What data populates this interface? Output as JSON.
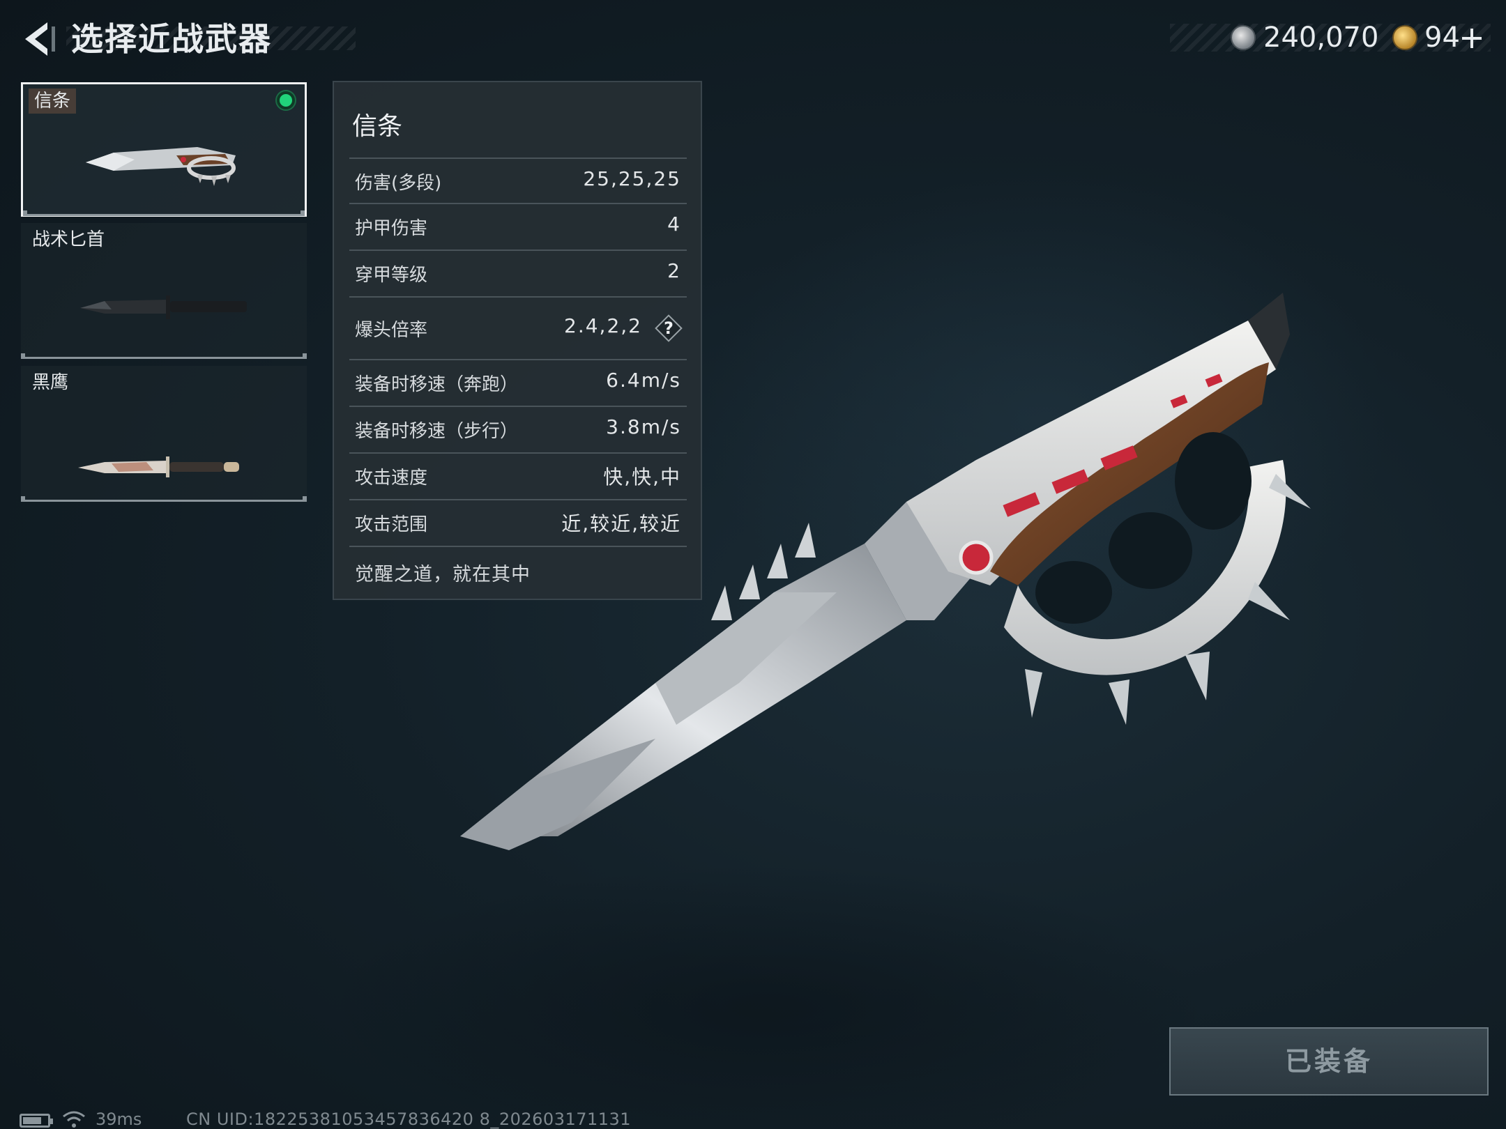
{
  "header": {
    "title": "选择近战武器",
    "silver_amount": "240,070",
    "gold_amount": "94",
    "gold_add_icon": "plus-icon"
  },
  "weapons": [
    {
      "name": "信条",
      "selected": true,
      "equipped": true
    },
    {
      "name": "战术匕首",
      "selected": false,
      "equipped": false
    },
    {
      "name": "黑鹰",
      "selected": false,
      "equipped": false
    }
  ],
  "stats_panel": {
    "weapon_name": "信条",
    "stats": [
      {
        "label": "伤害(多段)",
        "value": "25,25,25"
      },
      {
        "label": "护甲伤害",
        "value": "4"
      },
      {
        "label": "穿甲等级",
        "value": "2"
      },
      {
        "label": "爆头倍率",
        "value": "2.4,2,2"
      },
      {
        "label": "装备时移速（奔跑）",
        "value": "6.4m/s"
      },
      {
        "label": "装备时移速（步行）",
        "value": "3.8m/s"
      },
      {
        "label": "攻击速度",
        "value": "快,快,中"
      },
      {
        "label": "攻击范围",
        "value": "近,较近,较近"
      }
    ],
    "help_mark": "?",
    "flavor_text": "觉醒之道，就在其中"
  },
  "equip_button": {
    "label": "已装备"
  },
  "footer": {
    "ping": "39ms",
    "uid": "CN UID:18225381053457836420 8_202603171131"
  },
  "colors": {
    "equipped_dot": "#21d37a",
    "background": "#132028",
    "accent_red": "#c8283a"
  }
}
